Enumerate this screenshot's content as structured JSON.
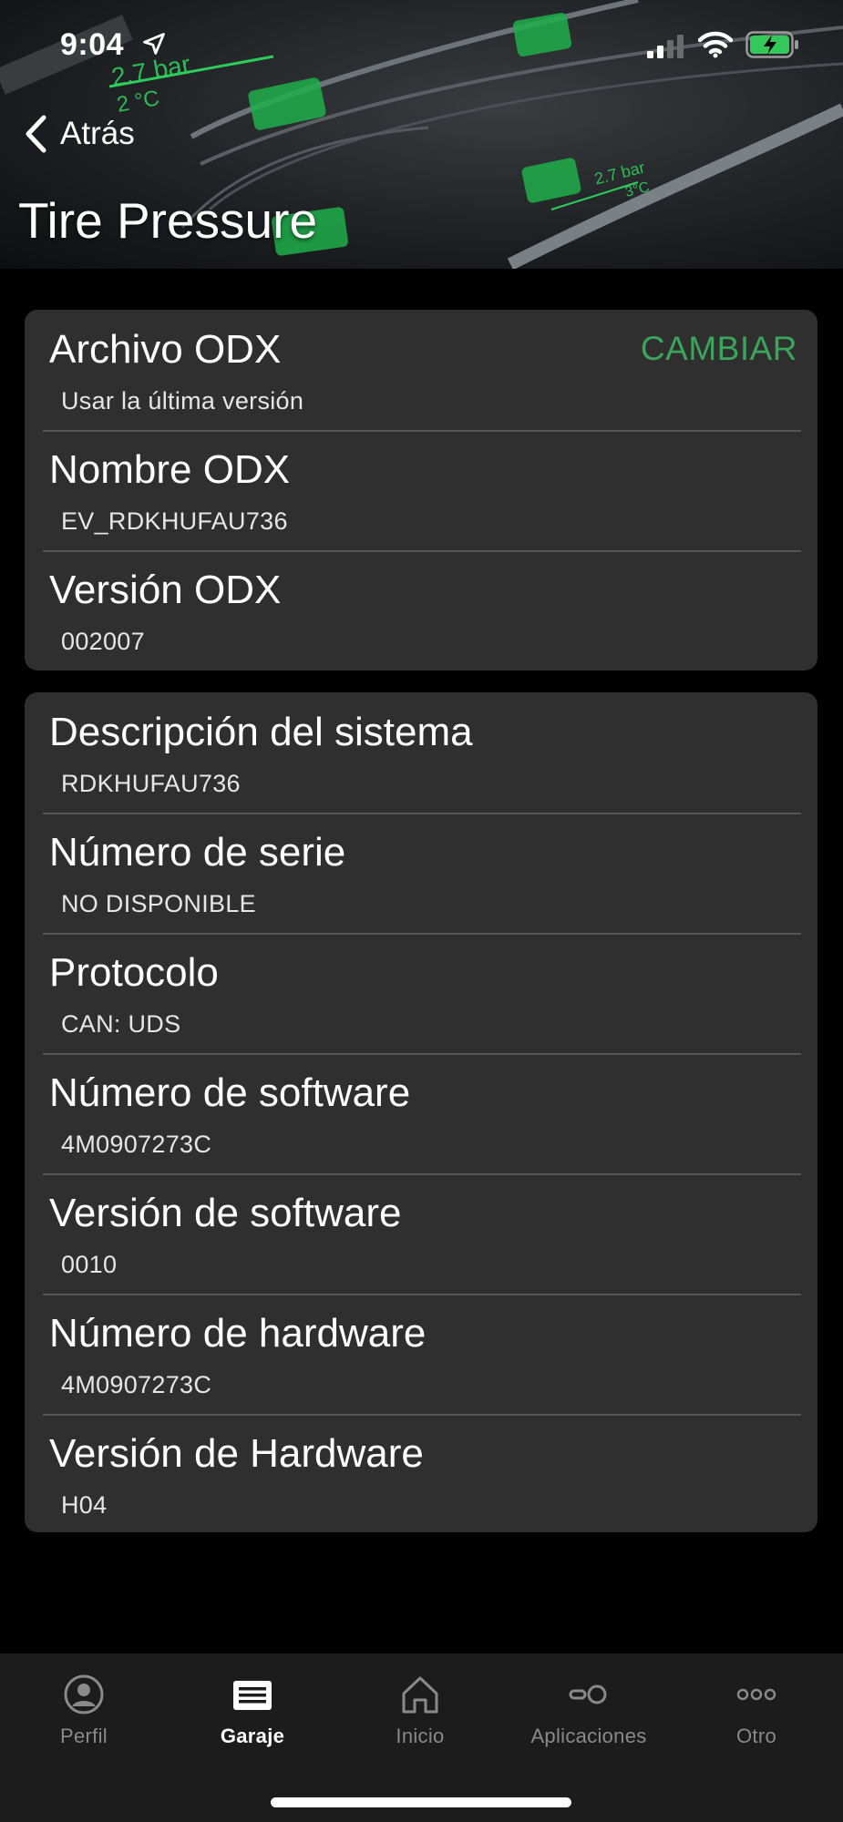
{
  "status_bar": {
    "time": "9:04"
  },
  "header": {
    "back_label": "Atrás",
    "title": "Tire Pressure",
    "image_labels": [
      "2.7 bar",
      "2 °C",
      "2.7 bar",
      "3°C"
    ]
  },
  "odx_card": {
    "rows": [
      {
        "title": "Archivo ODX",
        "value": "Usar la última versión",
        "action": "CAMBIAR"
      },
      {
        "title": "Nombre ODX",
        "value": "EV_RDKHUFAU736"
      },
      {
        "title": "Versión ODX",
        "value": "002007"
      }
    ]
  },
  "system_card": {
    "rows": [
      {
        "title": "Descripción del sistema",
        "value": "RDKHUFAU736"
      },
      {
        "title": "Número de serie",
        "value": "NO DISPONIBLE"
      },
      {
        "title": "Protocolo",
        "value": "CAN: UDS"
      },
      {
        "title": "Número de software",
        "value": "4M0907273C"
      },
      {
        "title": "Versión de software",
        "value": "0010"
      },
      {
        "title": "Número de hardware",
        "value": "4M0907273C"
      },
      {
        "title": "Versión de Hardware",
        "value": "H04"
      }
    ]
  },
  "tabbar": {
    "tabs": [
      {
        "label": "Perfil",
        "icon": "profile-icon",
        "active": false
      },
      {
        "label": "Garaje",
        "icon": "garage-icon",
        "active": true
      },
      {
        "label": "Inicio",
        "icon": "home-icon",
        "active": false
      },
      {
        "label": "Aplicaciones",
        "icon": "apps-icon",
        "active": false
      },
      {
        "label": "Otro",
        "icon": "more-icon",
        "active": false
      }
    ]
  },
  "colors": {
    "accent": "#3ca55c",
    "card": "#2f2f2f",
    "background": "#000000",
    "tabbar": "#1c1c1c"
  }
}
